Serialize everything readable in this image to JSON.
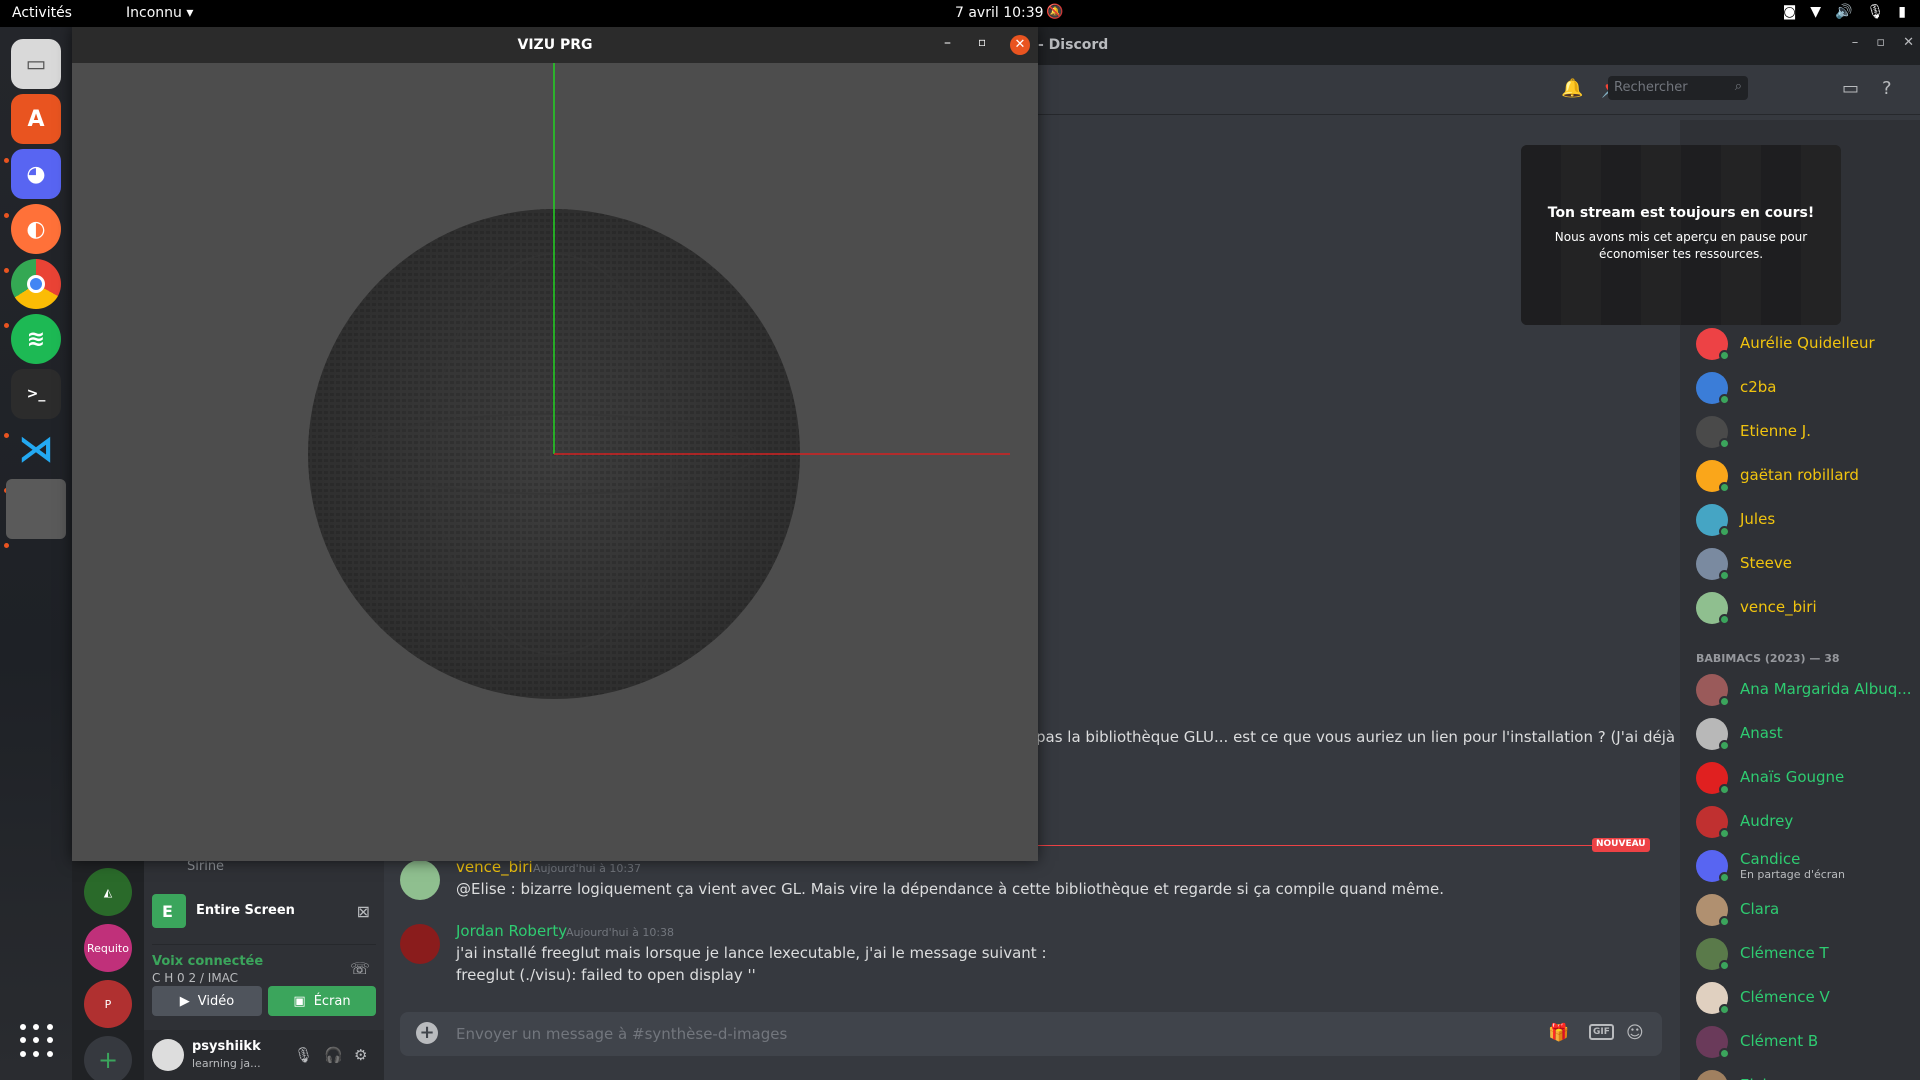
{
  "topbar": {
    "activities": "Activités",
    "app_menu": "Inconnu ▾",
    "clock": "7 avril  10:39",
    "tray_icons": [
      "discord-icon",
      "wifi-icon",
      "volume-icon",
      "mic-icon",
      "battery-icon"
    ]
  },
  "vizu": {
    "title": "VIZU PRG"
  },
  "discord": {
    "window_title": "- Discord",
    "search_placeholder": "Rechercher",
    "partial_message": "pas la bibliothèque GLU... est ce que vous auriez un lien pour l'installation ? (J'ai déjà",
    "new_divider_label": "NOUVEAU",
    "messages": [
      {
        "author": "vence_biri",
        "time": "Aujourd'hui à 10:37",
        "lines": [
          "@Elise : bizarre logiquement ça vient avec GL. Mais vire la dépendance à cette bibliothèque et regarde si ça compile quand même."
        ]
      },
      {
        "author": "Jordan Roberty",
        "time": "Aujourd'hui à 10:38",
        "lines": [
          "j'ai installé freeglut mais lorsque je lance lexecutable, j'ai le message suivant :",
          "freeglut (./visu): failed to open display ''"
        ]
      }
    ],
    "composer_placeholder": "Envoyer un message à #synthèse-d-images",
    "servers": [
      "Requito",
      "P"
    ],
    "channel_panel": {
      "voice_user": "Sirine",
      "stream_label": "Entire Screen",
      "stream_badge": "E",
      "voice_status": "Voix connectée",
      "voice_channel": "C H 0 2 / IMAC",
      "video_button": "Vidéo",
      "screen_button": "Écran"
    },
    "user": {
      "name": "psyshiikk",
      "status": "learning ja..."
    },
    "stream_preview": {
      "headline": "Ton stream est toujours en cours!",
      "body": "Nous avons mis cet aperçu en pause pour économiser tes ressources."
    },
    "members": {
      "admins": [
        {
          "name": "Aurélie Quidelleur",
          "color": "#f1c40f",
          "avatar": "#ed4245"
        },
        {
          "name": "c2ba",
          "color": "#f1c40f",
          "avatar": "#3b7dd8"
        },
        {
          "name": "Etienne J.",
          "color": "#f1c40f",
          "avatar": "#4a4a4a"
        },
        {
          "name": "gaëtan robillard",
          "color": "#f1c40f",
          "avatar": "#faa61a"
        },
        {
          "name": "Jules",
          "color": "#f1c40f",
          "avatar": "#45a5c4"
        },
        {
          "name": "Steeve",
          "color": "#f1c40f",
          "avatar": "#7a8aa0"
        },
        {
          "name": "vence_biri",
          "color": "#f1c40f",
          "avatar": "#8fbf8f"
        }
      ],
      "category": "BABIMACS (2023) — 38",
      "babimacs": [
        {
          "name": "Ana Margarida Albuq...",
          "color": "#2ecc71",
          "avatar": "#9a5a5a",
          "sub": ""
        },
        {
          "name": "Anast",
          "color": "#2ecc71",
          "avatar": "#b8b8b8",
          "sub": ""
        },
        {
          "name": "Anaïs Gougne",
          "color": "#2ecc71",
          "avatar": "#e02020",
          "sub": ""
        },
        {
          "name": "Audrey",
          "color": "#2ecc71",
          "avatar": "#c03030",
          "sub": ""
        },
        {
          "name": "Candice",
          "color": "#2ecc71",
          "avatar": "#5865f2",
          "sub": "En partage d'écran"
        },
        {
          "name": "Clara",
          "color": "#2ecc71",
          "avatar": "#b09070",
          "sub": ""
        },
        {
          "name": "Clémence T",
          "color": "#2ecc71",
          "avatar": "#5a7a4a",
          "sub": ""
        },
        {
          "name": "Clémence V",
          "color": "#2ecc71",
          "avatar": "#e0d0c0",
          "sub": ""
        },
        {
          "name": "Clément B",
          "color": "#2ecc71",
          "avatar": "#6a3a5a",
          "sub": ""
        },
        {
          "name": "Elvina",
          "color": "#2ecc71",
          "avatar": "#a08060",
          "sub": ""
        }
      ]
    }
  }
}
